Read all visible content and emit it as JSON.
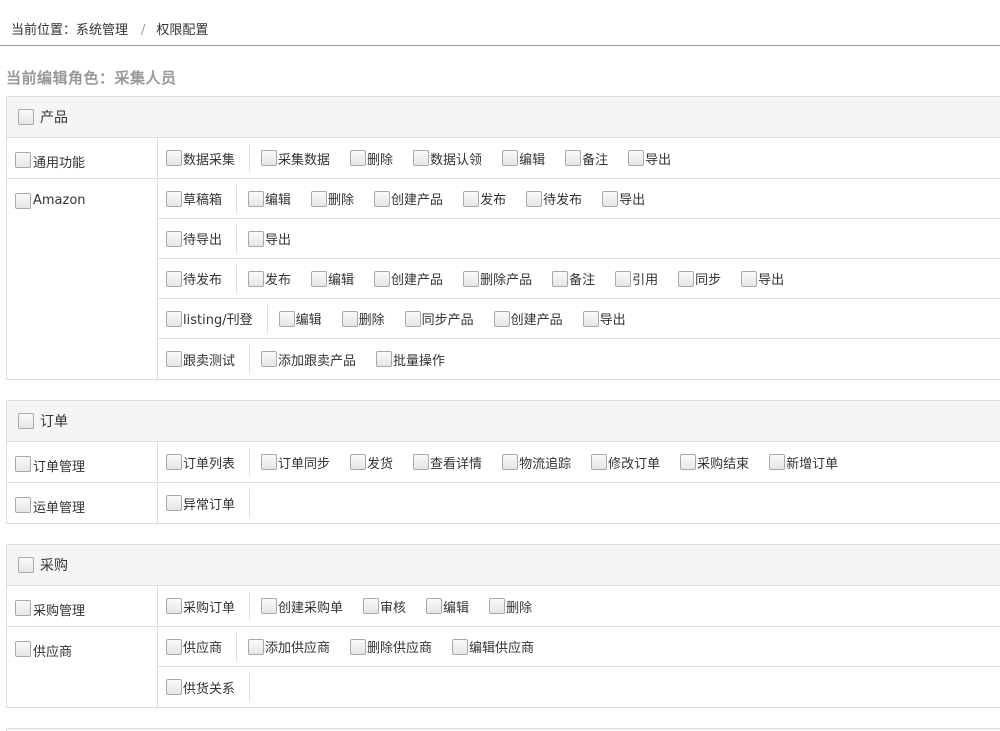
{
  "breadcrumb": {
    "prefix": "当前位置：系统管理",
    "separator": "/",
    "current": "权限配置"
  },
  "role_title": "当前编辑角色：采集人员",
  "sections": [
    {
      "title": "产品",
      "groups": [
        {
          "name": "通用功能",
          "rows": [
            {
              "lead": "数据采集",
              "items": [
                "采集数据",
                "删除",
                "数据认领",
                "编辑",
                "备注",
                "导出"
              ]
            }
          ]
        },
        {
          "name": "Amazon",
          "rows": [
            {
              "lead": "草稿箱",
              "items": [
                "编辑",
                "删除",
                "创建产品",
                "发布",
                "待发布",
                "导出"
              ]
            },
            {
              "lead": "待导出",
              "items": [
                "导出"
              ]
            },
            {
              "lead": "待发布",
              "items": [
                "发布",
                "编辑",
                "创建产品",
                "删除产品",
                "备注",
                "引用",
                "同步",
                "导出"
              ]
            },
            {
              "lead": "listing/刊登",
              "items": [
                "编辑",
                "删除",
                "同步产品",
                "创建产品",
                "导出"
              ]
            },
            {
              "lead": "跟卖测试",
              "items": [
                "添加跟卖产品",
                "批量操作"
              ]
            }
          ]
        }
      ]
    },
    {
      "title": "订单",
      "groups": [
        {
          "name": "订单管理",
          "rows": [
            {
              "lead": "订单列表",
              "items": [
                "订单同步",
                "发货",
                "查看详情",
                "物流追踪",
                "修改订单",
                "采购结束",
                "新增订单"
              ]
            }
          ]
        },
        {
          "name": "运单管理",
          "rows": [
            {
              "lead": "异常订单",
              "items": []
            }
          ]
        }
      ]
    },
    {
      "title": "采购",
      "groups": [
        {
          "name": "采购管理",
          "rows": [
            {
              "lead": "采购订单",
              "items": [
                "创建采购单",
                "审核",
                "编辑",
                "删除"
              ]
            }
          ]
        },
        {
          "name": "供应商",
          "rows": [
            {
              "lead": "供应商",
              "items": [
                "添加供应商",
                "删除供应商",
                "编辑供应商"
              ]
            },
            {
              "lead": "供货关系",
              "items": []
            }
          ]
        }
      ]
    }
  ]
}
